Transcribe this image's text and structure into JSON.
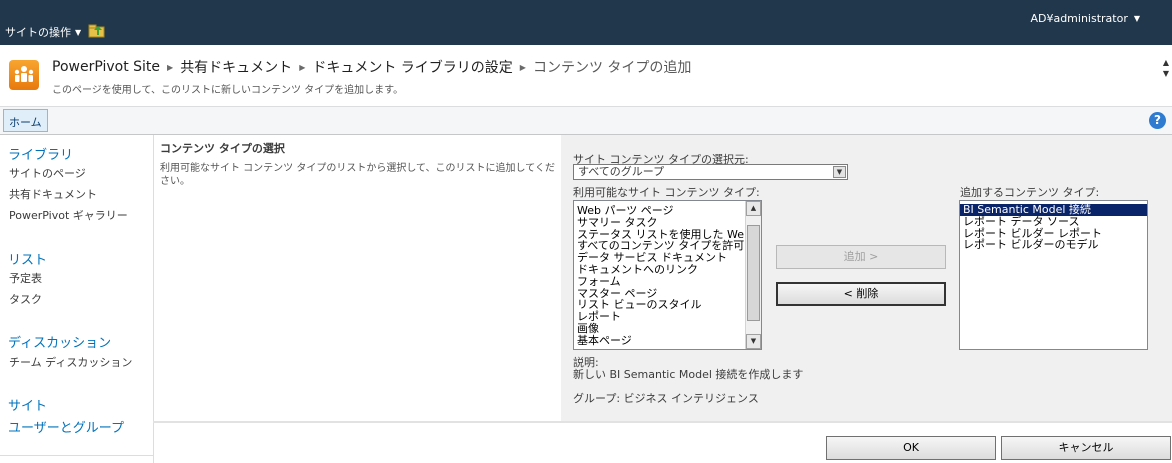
{
  "topbar": {
    "site_actions": "サイトの操作",
    "user": "AD¥administrator"
  },
  "title": {
    "breadcrumb": [
      "PowerPivot Site",
      "共有ドキュメント",
      "ドキュメント ライブラリの設定",
      "コンテンツ タイプの追加"
    ],
    "description": "このページを使用して、このリストに新しいコンテンツ タイプを追加します。"
  },
  "ribbon": {
    "home_tab": "ホーム",
    "help": "?"
  },
  "leftnav": {
    "libraries_heading": "ライブラリ",
    "libraries": [
      "サイトのページ",
      "共有ドキュメント",
      "PowerPivot ギャラリー"
    ],
    "lists_heading": "リスト",
    "lists": [
      "予定表",
      "タスク"
    ],
    "discussions_heading": "ディスカッション",
    "discussions": [
      "チーム ディスカッション"
    ],
    "sites_heading": "サイト",
    "users_groups": "ユーザーとグループ"
  },
  "section": {
    "title": "コンテンツ タイプの選択",
    "description": "利用可能なサイト コンテンツ タイプのリストから選択して、このリストに追加してください。"
  },
  "form": {
    "select_from_label": "サイト コンテンツ タイプの選択元:",
    "select_from_value": "すべてのグループ",
    "available_label": "利用可能なサイト コンテンツ タイプ:",
    "available_items": [
      "Web パーツ ページ",
      "サマリー タスク",
      "ステータス リストを使用した Web パーツ",
      "すべてのコンテンツ タイプを許可する",
      "データ サービス ドキュメント",
      "ドキュメントへのリンク",
      "フォーム",
      "マスター ページ",
      "リスト ビューのスタイル",
      "レポート",
      "画像",
      "基本ページ"
    ],
    "add_button": "追加 >",
    "remove_button": "< 削除",
    "to_add_label": "追加するコンテンツ タイプ:",
    "to_add_items": [
      "BI Semantic Model 接続",
      "レポート データ ソース",
      "レポート ビルダー レポート",
      "レポート ビルダーのモデル"
    ],
    "description_label": "説明:",
    "description_text": "新しい BI Semantic Model 接続を作成します",
    "group_text": "グループ: ビジネス インテリジェンス"
  },
  "footer": {
    "ok": "OK",
    "cancel": "キャンセル"
  },
  "colors": {
    "topbar": "#21374c",
    "link": "#0072bc",
    "selection": "#0a246a"
  }
}
